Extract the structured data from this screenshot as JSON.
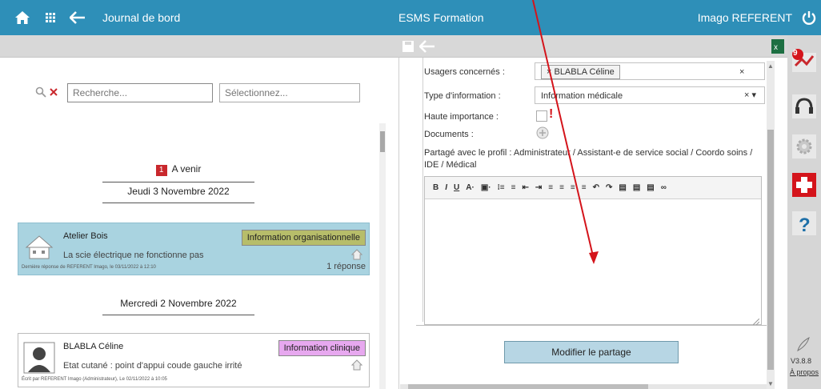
{
  "header": {
    "home_icon": "home-icon",
    "grid_icon": "grid-icon",
    "back_icon": "back-arrow-icon",
    "title": "Journal de bord",
    "center_title": "ESMS Formation",
    "user": "Imago REFERENT",
    "power_icon": "power-icon",
    "bg_color": "#2e8fb8"
  },
  "left_panel": {
    "search_placeholder": "Recherche...",
    "select_placeholder": "Sélectionnez...",
    "upcoming_badge": "1",
    "upcoming_label": "A venir",
    "date1": "Jeudi 3 Novembre 2022",
    "date2": "Mercredi 2 Novembre 2022",
    "cards": [
      {
        "name": "Atelier Bois",
        "message": "La scie électrique ne fonctionne pas",
        "tag": "Information organisationnelle",
        "tag_color": "#b7bd6a",
        "footer": "Dernière réponse de REFERENT Imago, le 03/11/2022 à 12:10",
        "replies": "1 réponse"
      },
      {
        "name": "BLABLA Céline",
        "message": "Etat cutané :  point d'appui coude gauche irrité",
        "tag": "Information clinique",
        "tag_color": "#e7a8ef",
        "footer": "Écrit par REFERENT Imago (Administrateur), Le 02/11/2022 à 10:05"
      }
    ]
  },
  "form": {
    "usagers_label": "Usagers concernés :",
    "usagers_token": "× BLABLA Céline",
    "type_label": "Type d'information :",
    "type_value": "Information médicale",
    "haute_label": "Haute importance :",
    "documents_label": "Documents :",
    "partage_text": "Partagé avec le profil : Administrateur / Assistant-e de service social / Coordo soins / IDE / Médical",
    "toolbar_items": [
      "B",
      "I",
      "U",
      "A·",
      "▣·",
      "⁝≡",
      "≡",
      "⇤",
      "⇥",
      "≡",
      "≡",
      "≡",
      "≡",
      "↶",
      "↷",
      "▤",
      "▤",
      "▤",
      "∞"
    ],
    "button_label": "Modifier le partage"
  },
  "sidebar": {
    "notif_count": "9",
    "version": "V3.8.8",
    "about": "À propos"
  },
  "accent": "#d4141b"
}
